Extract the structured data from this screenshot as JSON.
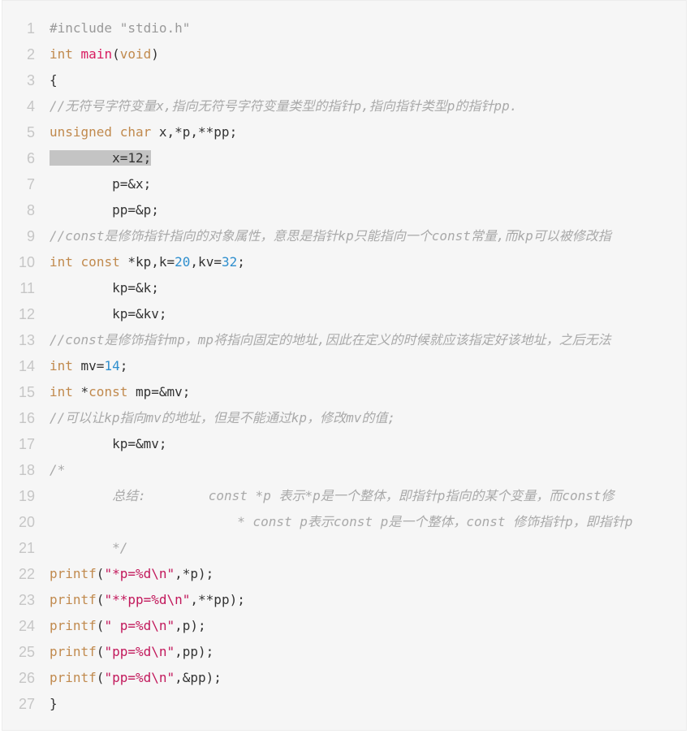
{
  "code_block": {
    "language": "c",
    "highlighted_line": 6,
    "lines": [
      {
        "n": "1",
        "tokens": [
          {
            "t": "#include \"stdio.h\"",
            "c": "pre"
          }
        ]
      },
      {
        "n": "2",
        "tokens": [
          {
            "t": "int",
            "c": "kw"
          },
          {
            "t": " ",
            "c": ""
          },
          {
            "t": "main",
            "c": "fn"
          },
          {
            "t": "(",
            "c": ""
          },
          {
            "t": "void",
            "c": "kw"
          },
          {
            "t": ")",
            "c": ""
          }
        ]
      },
      {
        "n": "3",
        "tokens": [
          {
            "t": "{",
            "c": ""
          }
        ]
      },
      {
        "n": "4",
        "tokens": [
          {
            "t": "//无符号字符变量x,指向无符号字符变量类型的指针p,指向指针类型p的指针pp.",
            "c": "cm"
          }
        ]
      },
      {
        "n": "5",
        "tokens": [
          {
            "t": "unsigned",
            "c": "kw"
          },
          {
            "t": " ",
            "c": ""
          },
          {
            "t": "char",
            "c": "kw"
          },
          {
            "t": " x,*p,**pp;",
            "c": ""
          }
        ]
      },
      {
        "n": "6",
        "tokens": [
          {
            "t": "        x=12;",
            "c": "hl"
          }
        ]
      },
      {
        "n": "7",
        "tokens": [
          {
            "t": "        p=&x;",
            "c": ""
          }
        ]
      },
      {
        "n": "8",
        "tokens": [
          {
            "t": "        pp=&p;",
            "c": ""
          }
        ]
      },
      {
        "n": "9",
        "tokens": [
          {
            "t": "//const是修饰指针指向的对象属性，意思是指针kp只能指向一个const常量,而kp可以被修改指",
            "c": "cm"
          }
        ]
      },
      {
        "n": "10",
        "tokens": [
          {
            "t": "int",
            "c": "kw"
          },
          {
            "t": " ",
            "c": ""
          },
          {
            "t": "const",
            "c": "kw"
          },
          {
            "t": " *kp,k=",
            "c": ""
          },
          {
            "t": "20",
            "c": "num"
          },
          {
            "t": ",kv=",
            "c": ""
          },
          {
            "t": "32",
            "c": "num"
          },
          {
            "t": ";",
            "c": ""
          }
        ]
      },
      {
        "n": "11",
        "tokens": [
          {
            "t": "        kp=&k;",
            "c": ""
          }
        ]
      },
      {
        "n": "12",
        "tokens": [
          {
            "t": "        kp=&kv;",
            "c": ""
          }
        ]
      },
      {
        "n": "13",
        "tokens": [
          {
            "t": "//const是修饰指针mp，mp将指向固定的地址,因此在定义的时候就应该指定好该地址，之后无法",
            "c": "cm"
          }
        ]
      },
      {
        "n": "14",
        "tokens": [
          {
            "t": "int",
            "c": "kw"
          },
          {
            "t": " mv=",
            "c": ""
          },
          {
            "t": "14",
            "c": "num"
          },
          {
            "t": ";",
            "c": ""
          }
        ]
      },
      {
        "n": "15",
        "tokens": [
          {
            "t": "int",
            "c": "kw"
          },
          {
            "t": " *",
            "c": ""
          },
          {
            "t": "const",
            "c": "kw"
          },
          {
            "t": " mp=&mv;",
            "c": ""
          }
        ]
      },
      {
        "n": "16",
        "tokens": [
          {
            "t": "//可以让kp指向mv的地址，但是不能通过kp，修改mv的值;",
            "c": "cm"
          }
        ]
      },
      {
        "n": "17",
        "tokens": [
          {
            "t": "        kp=&mv;",
            "c": ""
          }
        ]
      },
      {
        "n": "18",
        "tokens": [
          {
            "t": "/*",
            "c": "cm"
          }
        ]
      },
      {
        "n": "19",
        "tokens": [
          {
            "t": "        总结:        const *p 表示*p是一个整体，即指针p指向的某个变量，而const修",
            "c": "cm"
          }
        ]
      },
      {
        "n": "20",
        "tokens": [
          {
            "t": "                        * const p表示const p是一个整体，const 修饰指针p，即指针p",
            "c": "cm"
          }
        ]
      },
      {
        "n": "21",
        "tokens": [
          {
            "t": "        */",
            "c": "cm"
          }
        ]
      },
      {
        "n": "22",
        "tokens": [
          {
            "t": "printf",
            "c": "kw"
          },
          {
            "t": "(",
            "c": ""
          },
          {
            "t": "\"*p=%d\\n\"",
            "c": "str"
          },
          {
            "t": ",*p);",
            "c": ""
          }
        ]
      },
      {
        "n": "23",
        "tokens": [
          {
            "t": "printf",
            "c": "kw"
          },
          {
            "t": "(",
            "c": ""
          },
          {
            "t": "\"**pp=%d\\n\"",
            "c": "str"
          },
          {
            "t": ",**pp);",
            "c": ""
          }
        ]
      },
      {
        "n": "24",
        "tokens": [
          {
            "t": "printf",
            "c": "kw"
          },
          {
            "t": "(",
            "c": ""
          },
          {
            "t": "\" p=%d\\n\"",
            "c": "str"
          },
          {
            "t": ",p);",
            "c": ""
          }
        ]
      },
      {
        "n": "25",
        "tokens": [
          {
            "t": "printf",
            "c": "kw"
          },
          {
            "t": "(",
            "c": ""
          },
          {
            "t": "\"pp=%d\\n\"",
            "c": "str"
          },
          {
            "t": ",pp);",
            "c": ""
          }
        ]
      },
      {
        "n": "26",
        "tokens": [
          {
            "t": "printf",
            "c": "kw"
          },
          {
            "t": "(",
            "c": ""
          },
          {
            "t": "\"pp=%d\\n\"",
            "c": "str"
          },
          {
            "t": ",&pp);",
            "c": ""
          }
        ]
      },
      {
        "n": "27",
        "tokens": [
          {
            "t": "}",
            "c": ""
          }
        ]
      }
    ]
  }
}
